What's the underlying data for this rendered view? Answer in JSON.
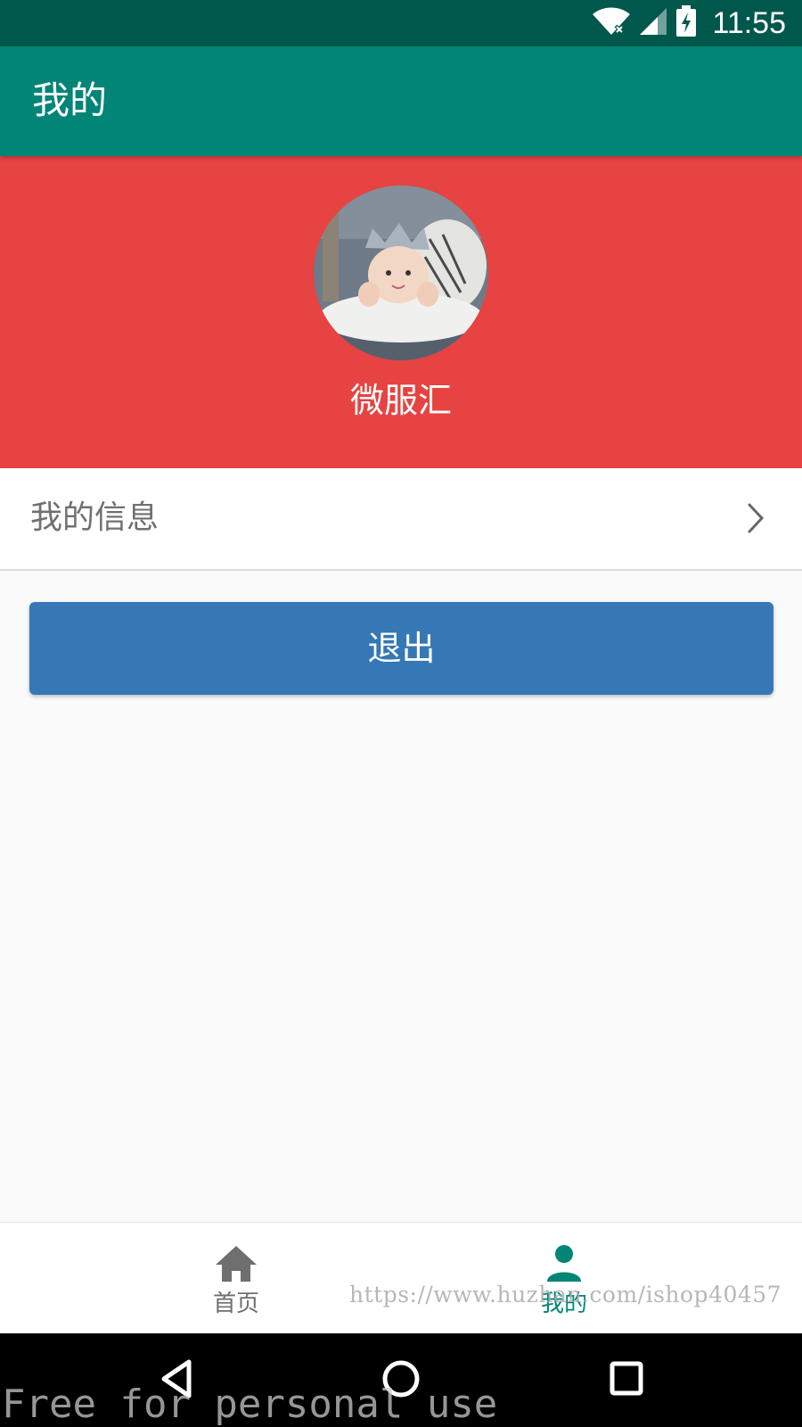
{
  "status_bar": {
    "time": "11:55",
    "icons": [
      "wifi-icon",
      "cellular-signal-icon",
      "battery-charging-icon"
    ]
  },
  "app_bar": {
    "title": "我的"
  },
  "profile": {
    "avatar": "avatar-photo",
    "username": "微服汇"
  },
  "menu": {
    "info_label": "我的信息",
    "info_icon": "chevron-right-icon"
  },
  "logout": {
    "label": "退出",
    "color": "#3578b5"
  },
  "bottom_nav": {
    "items": [
      {
        "label": "首页",
        "icon": "home-icon",
        "active": false
      },
      {
        "label": "我的",
        "icon": "person-icon",
        "active": true
      }
    ],
    "active_color": "#008577",
    "inactive_color": "#6f6f6f"
  },
  "watermarks": {
    "url": "https://www.huzhan.com/ishop40457",
    "free": "Free for personal use"
  },
  "system_nav": {
    "icons": [
      "back-icon",
      "home-circle-icon",
      "recents-icon"
    ]
  },
  "colors": {
    "status_bar": "#00574b",
    "app_bar": "#008577",
    "profile_header": "#e64342",
    "background": "#fafafa"
  }
}
